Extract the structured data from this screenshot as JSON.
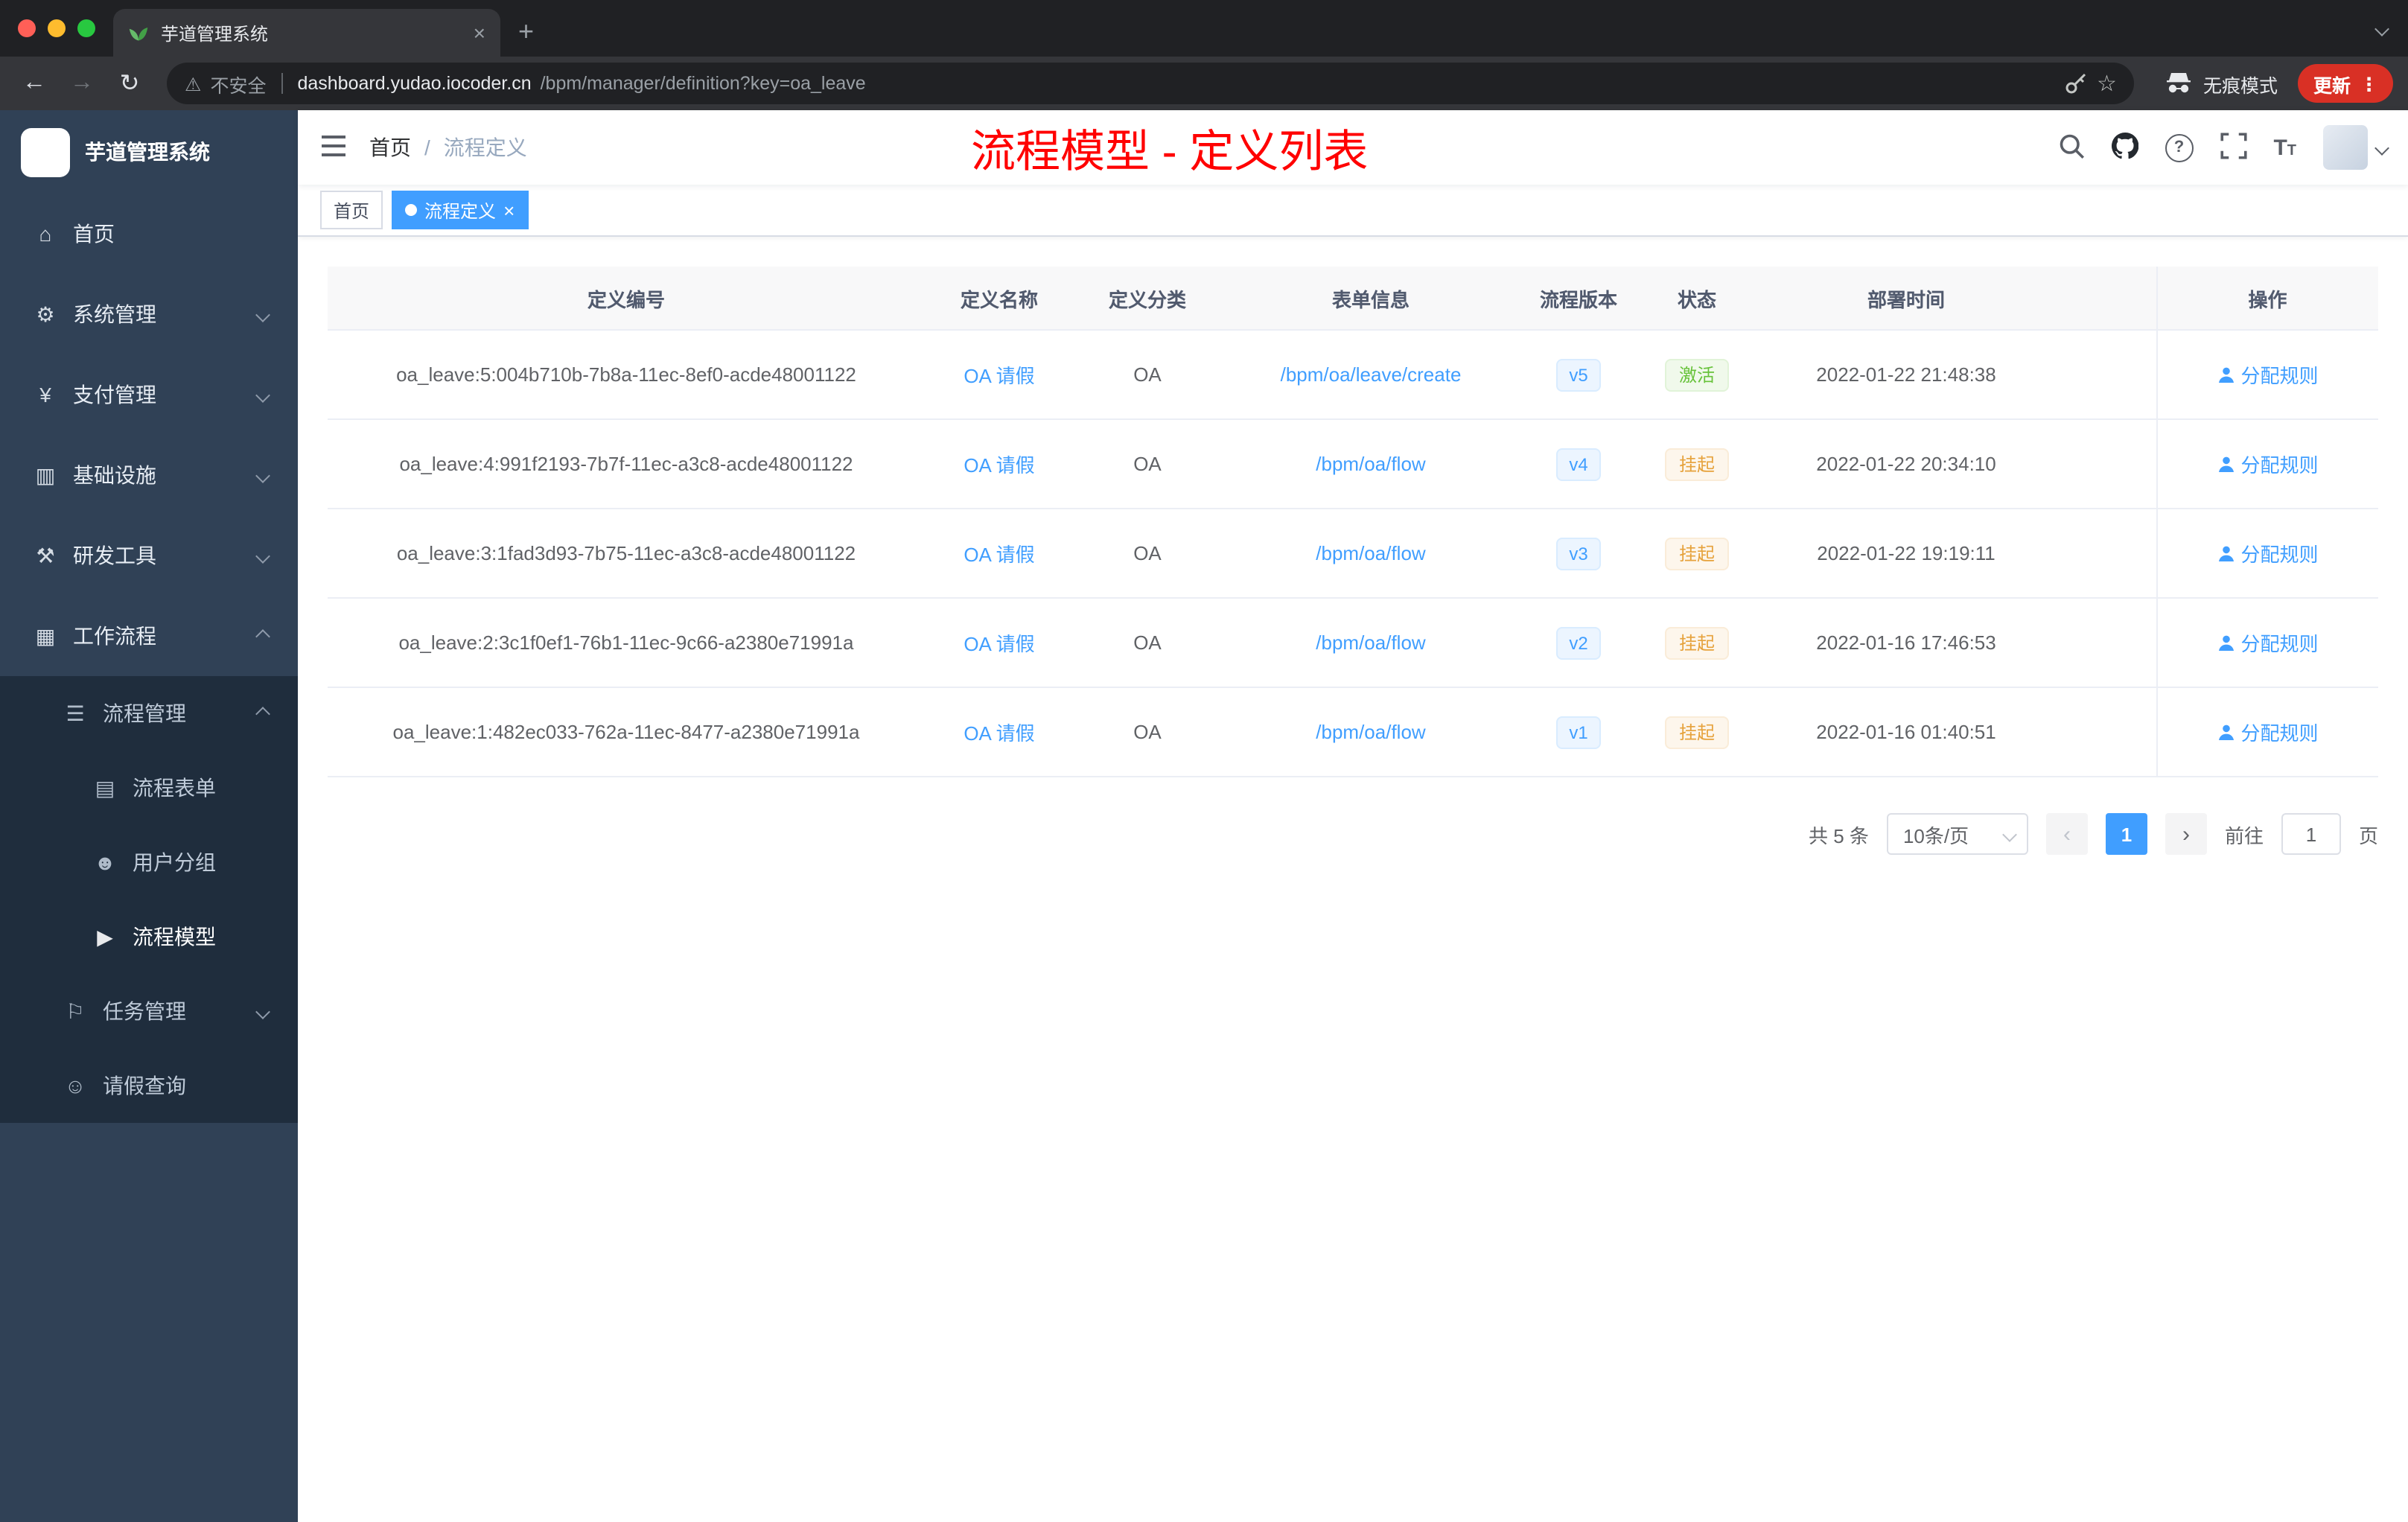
{
  "browser": {
    "tab_title": "芋道管理系统",
    "security_label": "不安全",
    "url_host": "dashboard.yudao.iocoder.cn",
    "url_path": "/bpm/manager/definition?key=oa_leave",
    "incognito_label": "无痕模式",
    "update_label": "更新"
  },
  "icons": {
    "back": "←",
    "forward": "→",
    "reload": "↻",
    "star": "☆",
    "warning": "⚠",
    "more": "⋮",
    "close": "×",
    "plus": "+",
    "prev": "‹",
    "next": "›",
    "help": "?",
    "font_large": "T",
    "font_small": "T"
  },
  "sidebar": {
    "logo_title": "芋道管理系统",
    "items": [
      {
        "label": "首页",
        "glyph": "⌂"
      },
      {
        "label": "系统管理",
        "glyph": "⚙"
      },
      {
        "label": "支付管理",
        "glyph": "¥"
      },
      {
        "label": "基础设施",
        "glyph": "▥"
      },
      {
        "label": "研发工具",
        "glyph": "⚒"
      },
      {
        "label": "工作流程",
        "glyph": "▦"
      },
      {
        "label": "流程管理",
        "glyph": "☰"
      },
      {
        "label": "流程表单",
        "glyph": "▤"
      },
      {
        "label": "用户分组",
        "glyph": "☻"
      },
      {
        "label": "流程模型",
        "glyph": "▶"
      },
      {
        "label": "任务管理",
        "glyph": "⚐"
      },
      {
        "label": "请假查询",
        "glyph": "☺"
      }
    ]
  },
  "header": {
    "breadcrumb_home": "首页",
    "breadcrumb_sep": "/",
    "breadcrumb_current": "流程定义",
    "page_title": "流程模型 - 定义列表"
  },
  "tags": {
    "home_label": "首页",
    "active_label": "流程定义"
  },
  "table": {
    "columns": [
      "定义编号",
      "定义名称",
      "定义分类",
      "表单信息",
      "流程版本",
      "状态",
      "部署时间",
      "操作"
    ],
    "rows": [
      {
        "id": "oa_leave:5:004b710b-7b8a-11ec-8ef0-acde48001122",
        "name": "OA 请假",
        "category": "OA",
        "form": "/bpm/oa/leave/create",
        "version": "v5",
        "status": "激活",
        "deploy_time": "2022-01-22 21:48:38",
        "action": "分配规则"
      },
      {
        "id": "oa_leave:4:991f2193-7b7f-11ec-a3c8-acde48001122",
        "name": "OA 请假",
        "category": "OA",
        "form": "/bpm/oa/flow",
        "version": "v4",
        "status": "挂起",
        "deploy_time": "2022-01-22 20:34:10",
        "action": "分配规则"
      },
      {
        "id": "oa_leave:3:1fad3d93-7b75-11ec-a3c8-acde48001122",
        "name": "OA 请假",
        "category": "OA",
        "form": "/bpm/oa/flow",
        "version": "v3",
        "status": "挂起",
        "deploy_time": "2022-01-22 19:19:11",
        "action": "分配规则"
      },
      {
        "id": "oa_leave:2:3c1f0ef1-76b1-11ec-9c66-a2380e71991a",
        "name": "OA 请假",
        "category": "OA",
        "form": "/bpm/oa/flow",
        "version": "v2",
        "status": "挂起",
        "deploy_time": "2022-01-16 17:46:53",
        "action": "分配规则"
      },
      {
        "id": "oa_leave:1:482ec033-762a-11ec-8477-a2380e71991a",
        "name": "OA 请假",
        "category": "OA",
        "form": "/bpm/oa/flow",
        "version": "v1",
        "status": "挂起",
        "deploy_time": "2022-01-16 01:40:51",
        "action": "分配规则"
      }
    ]
  },
  "pagination": {
    "total": "共 5 条",
    "page_size": "10条/页",
    "current": "1",
    "goto": "前往",
    "page_unit": "页",
    "goto_value": "1"
  }
}
